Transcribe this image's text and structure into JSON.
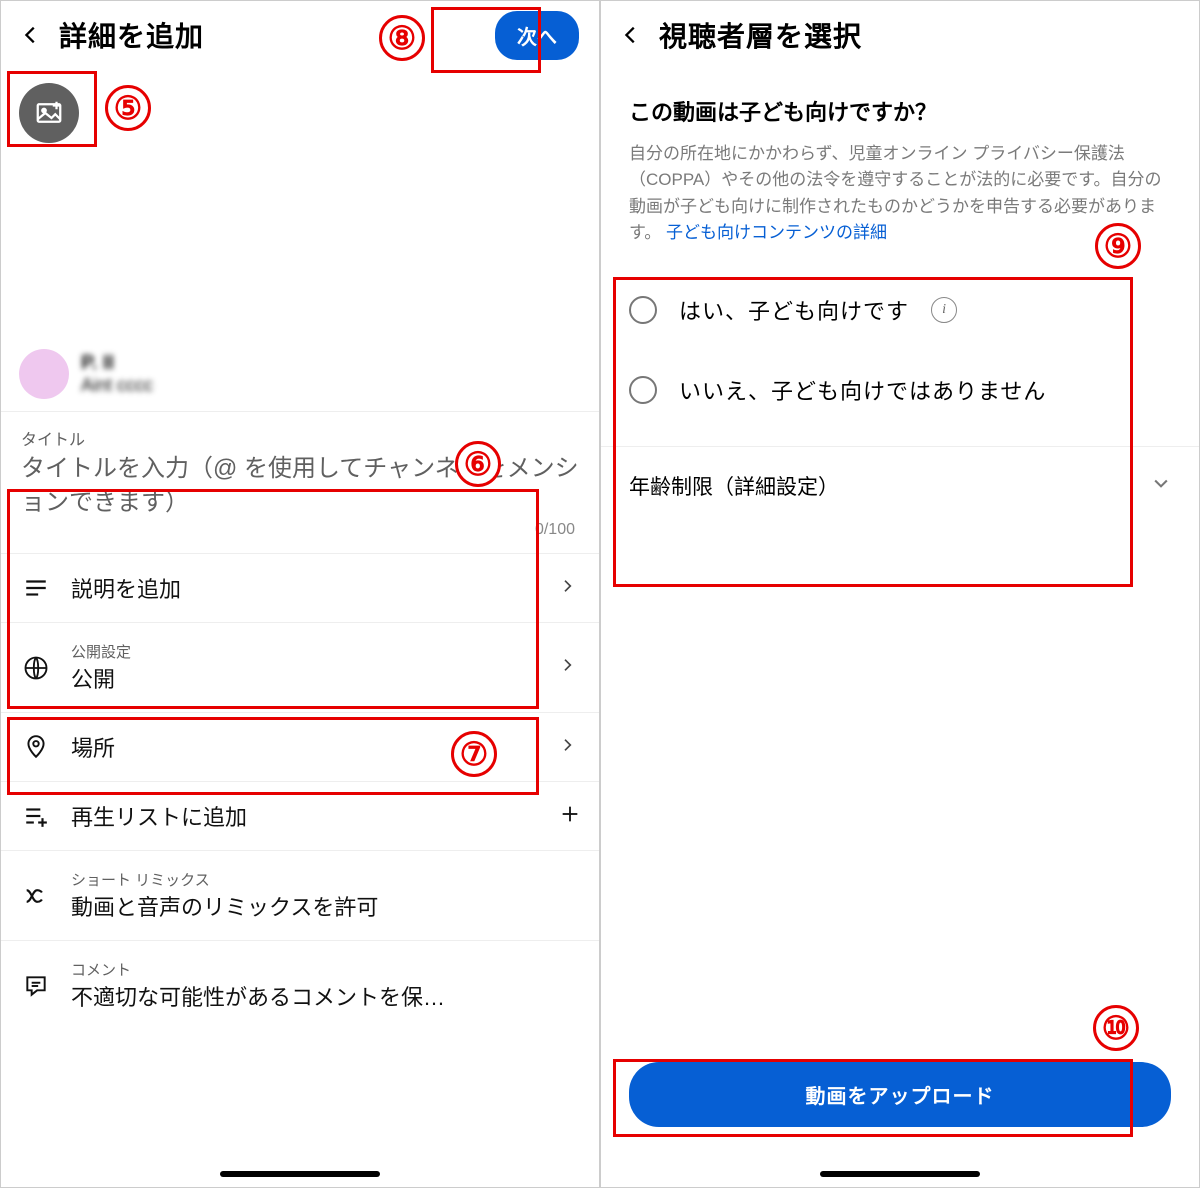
{
  "left": {
    "header_title": "詳細を追加",
    "next_button": "次へ",
    "user_name": "P. II",
    "user_sub": "Aint cccc",
    "title_label": "タイトル",
    "title_placeholder": "タイトルを入力（@ を使用してチャンネルをメンションできます）",
    "title_counter": "0/100",
    "add_description": "説明を追加",
    "visibility_label": "公開設定",
    "visibility_value": "公開",
    "location": "場所",
    "add_playlist": "再生リストに追加",
    "remix_label": "ショート リミックス",
    "remix_value": "動画と音声のリミックスを許可",
    "comment_label": "コメント",
    "comment_value": "不適切な可能性があるコメントを保…"
  },
  "right": {
    "header_title": "視聴者層を選択",
    "question": "この動画は子ども向けですか？",
    "description": "自分の所在地にかかわらず、児童オンライン プライバシー保護法（COPPA）やその他の法令を遵守することが法的に必要です。自分の動画が子ども向けに制作されたものかどうかを申告する必要があります。",
    "link": "子ども向けコンテンツの詳細",
    "option_yes": "はい、子ども向けです",
    "option_no": "いいえ、子ども向けではありません",
    "age_restriction": "年齢制限（詳細設定）",
    "upload_button": "動画をアップロード"
  },
  "annotations": {
    "n5": "⑤",
    "n6": "⑥",
    "n7": "⑦",
    "n8": "⑧",
    "n9": "⑨",
    "n10": "⑩"
  }
}
